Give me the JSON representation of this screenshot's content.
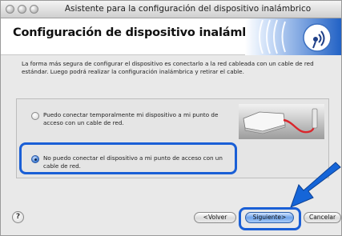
{
  "window": {
    "title": "Asistente para la configuración del dispositivo inalámbrico"
  },
  "header": {
    "title": "Configuración de dispositivo inalámbrico",
    "logo_icon": "wireless-signal-icon"
  },
  "intro": {
    "text": "La forma más segura de configurar el dispositivo es conectarlo a la red cableada con un cable de red estándar. Luego podrá realizar la configuración inalámbrica y retirar el cable."
  },
  "options": [
    {
      "label": "Puedo conectar temporalmente mi dispositivo a mi punto de acceso con un cable de red.",
      "selected": false
    },
    {
      "label": "No puedo conectar el dispositivo a mi punto de acceso con un cable de red.",
      "selected": true
    }
  ],
  "footer": {
    "help_label": "?",
    "back_label": "<Volver",
    "next_label": "Siguiente>",
    "cancel_label": "Cancelar"
  },
  "colors": {
    "highlight": "#1a5fd6",
    "accent_arrow": "#1565d8"
  }
}
